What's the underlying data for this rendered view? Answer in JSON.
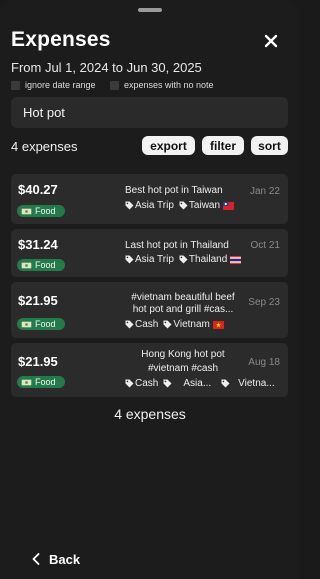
{
  "header": {
    "title": "Expenses",
    "close_icon": "close-icon"
  },
  "date_range": "From Jul 1, 2024 to Jun 30, 2025",
  "checkboxes": {
    "ignore_date_range": "ignore date range",
    "no_note": "expenses with no note"
  },
  "search": {
    "value": "Hot pot"
  },
  "toolbar": {
    "count_label": "4 expenses",
    "export": "export",
    "filter": "filter",
    "sort": "sort"
  },
  "expenses": [
    {
      "amount": "$40.27",
      "category": "Food",
      "description": "Best hot pot in Taiwan",
      "tags": [
        "Asia Trip",
        "Taiwan"
      ],
      "flag": "Taiwan",
      "date": "Jan 22"
    },
    {
      "amount": "$31.24",
      "category": "Food",
      "description": "Last hot pot in Thailand",
      "tags": [
        "Asia Trip",
        "Thailand"
      ],
      "flag": "Thailand",
      "date": "Oct 21"
    },
    {
      "amount": "$21.95",
      "category": "Food",
      "description_line1": "#vietnam beautiful beef",
      "description_line2": "hot pot and grill #cas...",
      "tags": [
        "Cash",
        "Vietnam"
      ],
      "flag": "Vietnam",
      "date": "Sep 23"
    },
    {
      "amount": "$21.95",
      "category": "Food",
      "description_line1": "Hong Kong hot pot",
      "description_line2": "#vietnam #cash",
      "tags": [
        "Cash",
        "",
        "Asia...",
        "Vietna..."
      ],
      "date": "Aug 18"
    }
  ],
  "footer": {
    "count_label": "4 expenses"
  },
  "back": {
    "label": "Back"
  },
  "colors": {
    "background": "#1c1c1c",
    "card": "#2b2b2b",
    "category_pill": "#237a4a",
    "date_text": "#8a8a8a"
  }
}
